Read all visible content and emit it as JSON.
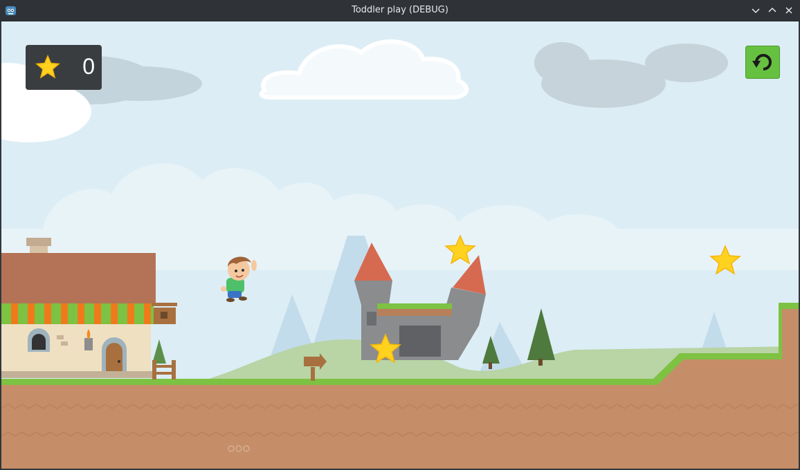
{
  "window": {
    "title": "Toddler play (DEBUG)"
  },
  "hud": {
    "star_count": "0"
  },
  "icons": {
    "app": "godot-icon",
    "minimize": "chevron-down-icon",
    "maximize": "chevron-up-icon",
    "close": "close-icon",
    "score": "star-icon",
    "reset": "restart-icon"
  },
  "colors": {
    "sky": "#dcedf5",
    "grass": "#7dc242",
    "dirt": "#c58e68",
    "star": "#ffd21f",
    "hud_bg": "#3a3d40",
    "reset_button": "#67c140"
  }
}
